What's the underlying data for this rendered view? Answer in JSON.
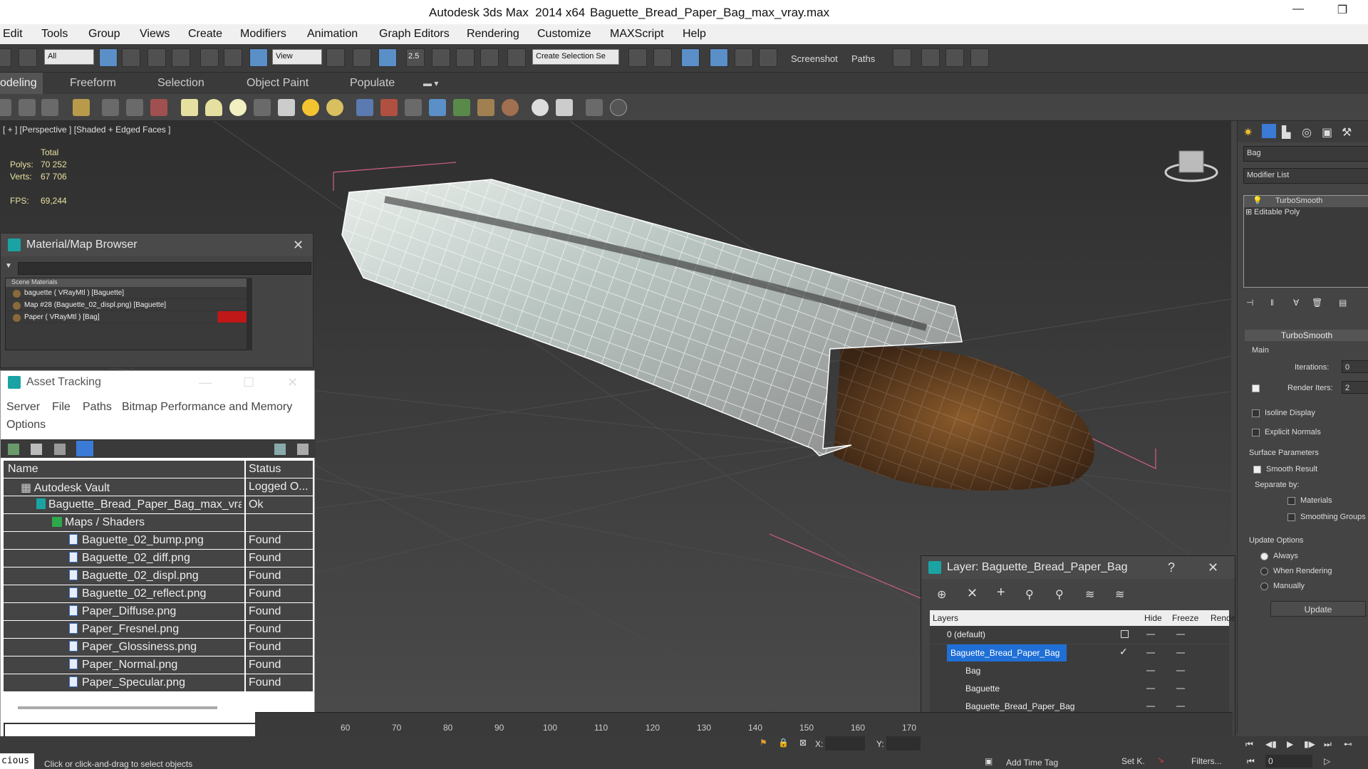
{
  "window": {
    "app_title": "Autodesk 3ds Max  2014 x64",
    "file_title": "Baguette_Bread_Paper_Bag_max_vray.max"
  },
  "menu": [
    "Edit",
    "Tools",
    "Group",
    "Views",
    "Create",
    "Modifiers",
    "Animation",
    "Graph Editors",
    "Rendering",
    "Customize",
    "MAXScript",
    "Help"
  ],
  "toolbar": {
    "filter_value": "All",
    "refcoord_value": "View",
    "selection_set": "Create Selection Se",
    "screenshot_label": "Screenshot",
    "paths_label": "Paths",
    "snap_label": "2.5"
  },
  "ribbon_tabs": [
    "odeling",
    "Freeform",
    "Selection",
    "Object Paint",
    "Populate"
  ],
  "viewport": {
    "label": "[ + ] [Perspective ] [Shaded + Edged Faces ]",
    "stats_total": "Total",
    "polys_label": "Polys:",
    "polys": "70 252",
    "verts_label": "Verts:",
    "verts": "67 706",
    "fps_label": "FPS:",
    "fps": "69,244"
  },
  "material_browser": {
    "title": "Material/Map Browser",
    "section": "Scene Materials",
    "items": [
      "baguette ( VRayMtl ) [Baguette]",
      "Map #28 (Baguette_02_displ.png) [Baguette]",
      "Paper ( VRayMtl ) [Bag]"
    ]
  },
  "asset_tracking": {
    "title": "Asset Tracking",
    "menu": [
      "Server",
      "File",
      "Paths",
      "Bitmap Performance and Memory",
      "Options"
    ],
    "columns": [
      "Name",
      "Status"
    ],
    "rows": [
      {
        "name": "Autodesk Vault",
        "status": "Logged O..."
      },
      {
        "name": "Baguette_Bread_Paper_Bag_max_vra...",
        "status": "Ok"
      },
      {
        "name": "Maps / Shaders",
        "status": ""
      },
      {
        "name": "Baguette_02_bump.png",
        "status": "Found"
      },
      {
        "name": "Baguette_02_diff.png",
        "status": "Found"
      },
      {
        "name": "Baguette_02_displ.png",
        "status": "Found"
      },
      {
        "name": "Baguette_02_reflect.png",
        "status": "Found"
      },
      {
        "name": "Paper_Diffuse.png",
        "status": "Found"
      },
      {
        "name": "Paper_Fresnel.png",
        "status": "Found"
      },
      {
        "name": "Paper_Glossiness.png",
        "status": "Found"
      },
      {
        "name": "Paper_Normal.png",
        "status": "Found"
      },
      {
        "name": "Paper_Specular.png",
        "status": "Found"
      }
    ]
  },
  "command_panel": {
    "object_name": "Bag",
    "modifier_list": "Modifier List",
    "stack": [
      "TurboSmooth",
      "Editable Poly"
    ],
    "rollout_title": "TurboSmooth",
    "main_label": "Main",
    "iterations_label": "Iterations:",
    "iterations": "0",
    "render_iters_label": "Render Iters:",
    "render_iters": "2",
    "isoline": "Isoline Display",
    "explicit_normals": "Explicit Normals",
    "surface_params": "Surface Parameters",
    "smooth_result": "Smooth Result",
    "separate_by": "Separate by:",
    "materials": "Materials",
    "smoothing_groups": "Smoothing Groups",
    "update_options": "Update Options",
    "always": "Always",
    "when_rendering": "When Rendering",
    "manually": "Manually",
    "update_btn": "Update"
  },
  "layer_dialog": {
    "title": "Layer: Baguette_Bread_Paper_Bag",
    "columns": [
      "Layers",
      "Hide",
      "Freeze",
      "Rende"
    ],
    "rows": [
      "0 (default)",
      "Baguette_Bread_Paper_Bag",
      "Bag",
      "Baguette",
      "Baguette_Bread_Paper_Bag"
    ]
  },
  "timeline": {
    "ticks": [
      "60",
      "70",
      "80",
      "90",
      "100",
      "110",
      "120",
      "130",
      "140",
      "150",
      "160",
      "170"
    ]
  },
  "status": {
    "prompt": "Click or click-and-drag to select objects",
    "left_label": "cious",
    "add_time_tag": "Add Time Tag",
    "set_key": "Set K.",
    "filters": "Filters...",
    "x_label": "X:",
    "y_label": "Y:",
    "frame": "0"
  }
}
